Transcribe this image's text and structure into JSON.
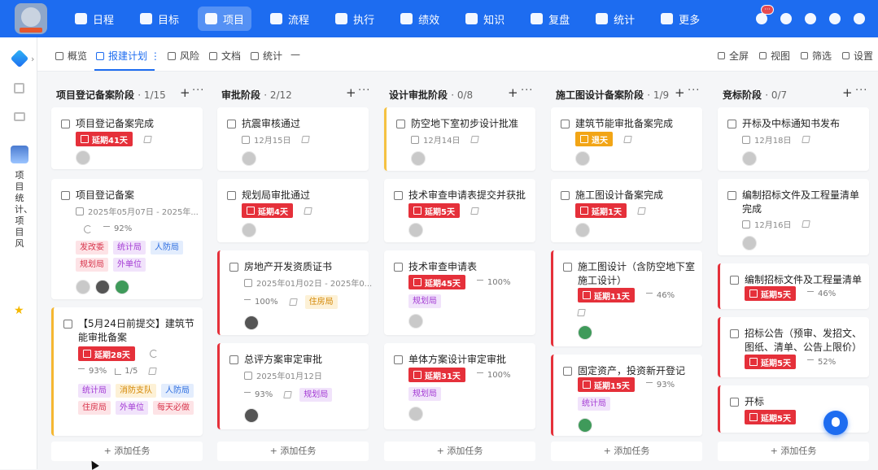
{
  "topnav": {
    "items": [
      {
        "label": "日程",
        "active": false
      },
      {
        "label": "目标",
        "active": false
      },
      {
        "label": "项目",
        "active": true
      },
      {
        "label": "流程",
        "active": false
      },
      {
        "label": "执行",
        "active": false
      },
      {
        "label": "绩效",
        "active": false
      },
      {
        "label": "知识",
        "active": false
      },
      {
        "label": "复盘",
        "active": false
      },
      {
        "label": "统计",
        "active": false
      },
      {
        "label": "更多",
        "active": false
      }
    ],
    "notification_count": "···"
  },
  "sidebar": {
    "project_name": "项目统计、项目风"
  },
  "tabs": [
    {
      "label": "概览",
      "active": false
    },
    {
      "label": "报建计划 ⋮",
      "active": true
    },
    {
      "label": "风险",
      "active": false
    },
    {
      "label": "文档",
      "active": false
    },
    {
      "label": "统计",
      "active": false
    },
    {
      "label": "—",
      "active": false
    }
  ],
  "toolbar": {
    "fullscreen": "全屏",
    "view": "视图",
    "filter": "筛选",
    "settings": "设置"
  },
  "add_task_label": "+ 添加任务",
  "columns": [
    {
      "title": "项目登记备案阶段",
      "count": "· 1/15",
      "cards": [
        {
          "title": "项目登记备案完成",
          "late": "延期41天"
        },
        {
          "title": "项目登记备案",
          "date": "2025年05月07日 - 2025年...",
          "progress": "92%",
          "tags": [
            "发改委",
            "统计局",
            "人防局",
            "规划局",
            "外单位"
          ]
        },
        {
          "title": "【5月24日前提交】建筑节能审批备案",
          "late": "延期28天",
          "progress": "93%",
          "sub": "1/5",
          "tags": [
            "统计局",
            "消防支队",
            "人防局",
            "住房局",
            "外单位",
            "每天必做"
          ]
        }
      ]
    },
    {
      "title": "审批阶段",
      "count": "· 2/12",
      "cards": [
        {
          "title": "抗震审核通过",
          "date": "12月15日"
        },
        {
          "title": "规划局审批通过",
          "late": "延期4天"
        },
        {
          "title": "房地产开发资质证书",
          "date": "2025年01月02日 - 2025年0...",
          "progress": "100%",
          "tags": [
            "住房局"
          ]
        },
        {
          "title": "总评方案审定审批",
          "date": "2025年01月12日",
          "progress": "93%",
          "tags": [
            "规划局"
          ]
        }
      ]
    },
    {
      "title": "设计审批阶段",
      "count": "· 0/8",
      "cards": [
        {
          "title": "防空地下室初步设计批准",
          "date": "12月14日"
        },
        {
          "title": "技术审查申请表提交并获批",
          "late": "延期5天"
        },
        {
          "title": "技术审查申请表",
          "late": "延期45天",
          "progress": "100%",
          "tags": [
            "规划局"
          ]
        },
        {
          "title": "单体方案设计审定审批",
          "late": "延期31天",
          "progress": "100%",
          "tags": [
            "规划局"
          ]
        }
      ]
    },
    {
      "title": "施工图设计备案阶段",
      "count": "· 1/9",
      "cards": [
        {
          "title": "建筑节能审批备案完成",
          "late": "退天"
        },
        {
          "title": "施工图设计备案完成",
          "late": "延期1天"
        },
        {
          "title": "施工图设计（含防空地下室施工设计）",
          "late": "延期11天",
          "progress": "46%"
        },
        {
          "title": "固定资产，投资新开登记",
          "late": "延期15天",
          "progress": "93%",
          "tags": [
            "统计局"
          ]
        }
      ]
    },
    {
      "title": "竞标阶段",
      "count": "· 0/7",
      "cards": [
        {
          "title": "开标及中标通知书发布",
          "date": "12月18日"
        },
        {
          "title": "编制招标文件及工程量清单完成",
          "date": "12月16日"
        },
        {
          "title": "编制招标文件及工程量清单",
          "late": "延期5天",
          "progress": "46%"
        },
        {
          "title": "招标公告（预审、发招文、图纸、清单、公告上限价）",
          "late": "延期5天",
          "progress": "52%"
        },
        {
          "title": "开标",
          "late": "延期5天"
        }
      ]
    }
  ]
}
